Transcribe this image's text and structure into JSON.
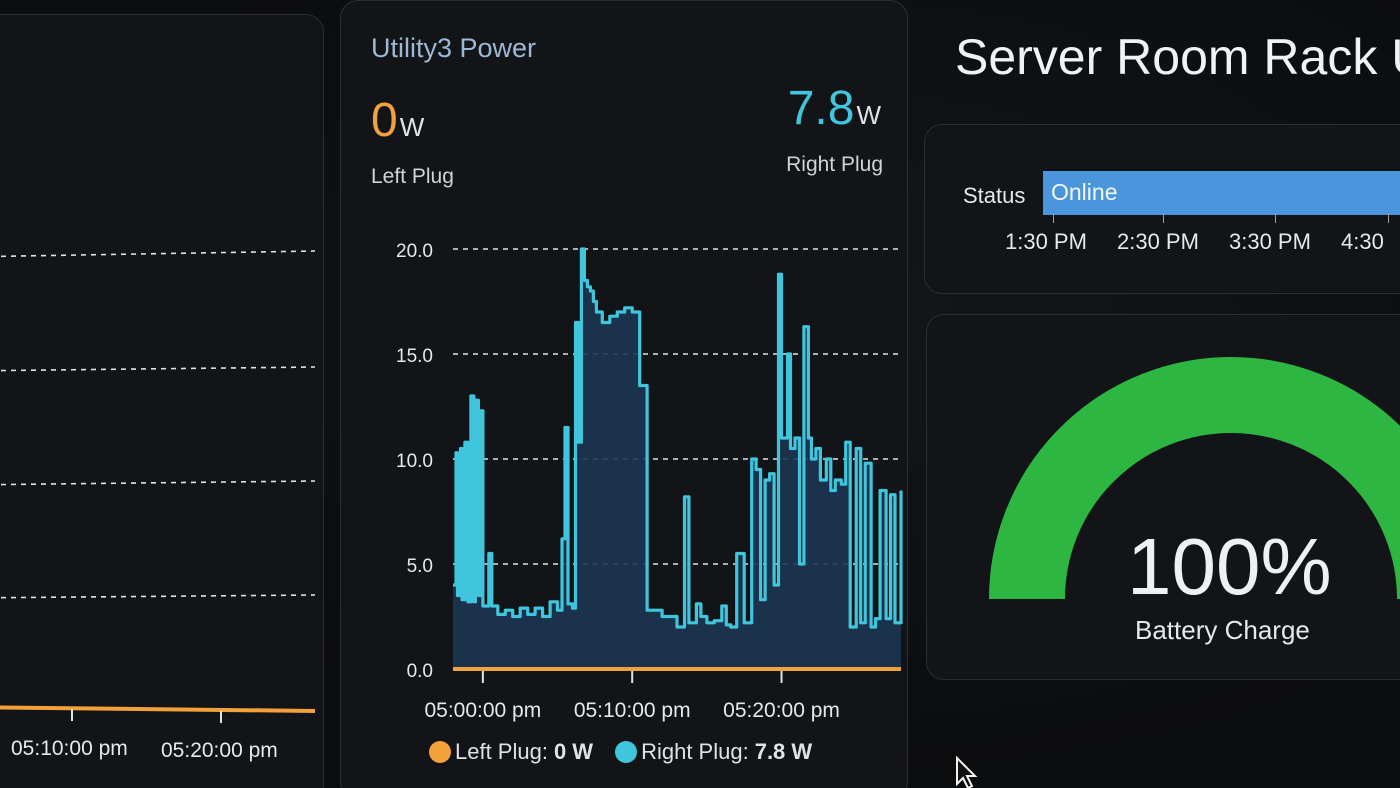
{
  "left_panel": {
    "x_labels": [
      "05:10:00 pm",
      "05:20:00 pm"
    ]
  },
  "utility": {
    "title": "Utility3 Power",
    "left_value": "0",
    "left_unit": "W",
    "left_label": "Left Plug",
    "right_value": "7.8",
    "right_unit": "W",
    "right_label": "Right Plug",
    "legend": {
      "left_name": "Left Plug:",
      "left_value": "0 W",
      "right_name": "Right Plug:",
      "right_value": "7.8 W"
    },
    "colors": {
      "left": "#f2a13b",
      "right": "#3fc5dc",
      "fill": "#1d3552"
    }
  },
  "chart_data": {
    "type": "area",
    "ylim": [
      0,
      20
    ],
    "y_ticks": [
      "0.0",
      "5.0",
      "10.0",
      "15.0",
      "20.0"
    ],
    "x_tick_labels": [
      "05:00:00 pm",
      "05:10:00 pm",
      "05:20:00 pm"
    ],
    "x_range_minutes": [
      0,
      30
    ],
    "x_tick_minutes": [
      2,
      12,
      22
    ],
    "grid": "dashed-horizontal",
    "series": [
      {
        "name": "Right Plug",
        "color": "#3fc5dc",
        "x": [
          0,
          0.2,
          0.3,
          0.5,
          0.6,
          0.8,
          1.0,
          1.2,
          1.4,
          1.5,
          1.7,
          1.9,
          2.0,
          2.2,
          2.4,
          2.6,
          3.0,
          3.5,
          4.0,
          4.5,
          5.0,
          5.5,
          6.0,
          6.5,
          7.0,
          7.3,
          7.5,
          7.7,
          8.0,
          8.2,
          8.4,
          8.6,
          8.8,
          9.0,
          9.2,
          9.4,
          9.6,
          9.8,
          10.0,
          10.5,
          11.0,
          11.5,
          12.0,
          12.5,
          13.0,
          14.0,
          15.0,
          15.5,
          15.8,
          16.0,
          16.3,
          16.6,
          17.0,
          17.5,
          18.0,
          18.3,
          18.6,
          19.0,
          19.5,
          20.0,
          20.3,
          20.6,
          20.9,
          21.2,
          21.5,
          21.8,
          22.0,
          22.2,
          22.4,
          22.6,
          22.9,
          23.2,
          23.5,
          23.8,
          24.0,
          24.3,
          24.6,
          25.0,
          25.3,
          25.6,
          26.0,
          26.3,
          26.6,
          27.0,
          27.3,
          27.6,
          28.0,
          28.3,
          28.6,
          29.0,
          29.3,
          29.6,
          30.0
        ],
        "values": [
          4,
          10.3,
          3.5,
          10.5,
          3.3,
          10.8,
          3.2,
          13,
          3.2,
          12.8,
          3.5,
          12.3,
          3.0,
          3.0,
          5.5,
          3.0,
          2.6,
          2.8,
          2.5,
          2.9,
          2.6,
          2.9,
          2.5,
          3.2,
          2.8,
          6.2,
          11.5,
          3.1,
          2.9,
          16.5,
          10.8,
          20,
          18.5,
          18.2,
          18.0,
          17.5,
          17.0,
          17.0,
          16.5,
          16.8,
          17.0,
          17.2,
          17.0,
          13.5,
          2.8,
          2.5,
          2.0,
          8.2,
          2.2,
          2.2,
          3.1,
          2.5,
          2.2,
          2.3,
          3.0,
          2.1,
          2.0,
          5.5,
          2.2,
          10.0,
          9.5,
          3.3,
          9.0,
          9.3,
          4.0,
          18.8,
          11.0,
          11.0,
          15.0,
          10.5,
          11.0,
          5.0,
          16.3,
          11.0,
          10.0,
          10.5,
          9.0,
          10.0,
          8.5,
          9.0,
          8.8,
          10.8,
          2.0,
          10.5,
          2.2,
          9.8,
          2.0,
          2.4,
          8.5,
          2.4,
          8.3,
          2.2,
          8.5
        ]
      },
      {
        "name": "Left Plug",
        "color": "#f2a13b",
        "x": [
          0,
          30
        ],
        "values": [
          0,
          0
        ]
      }
    ]
  },
  "server": {
    "title": "Server Room Rack UPS",
    "status_label": "Status",
    "status_value": "Online",
    "status_color": "#4a95dc",
    "times": [
      "1:30 PM",
      "2:30 PM",
      "3:30 PM",
      "4:30"
    ]
  },
  "gauge": {
    "value_text": "100%",
    "label": "Battery Charge",
    "percent": 100,
    "color": "#2db742"
  }
}
